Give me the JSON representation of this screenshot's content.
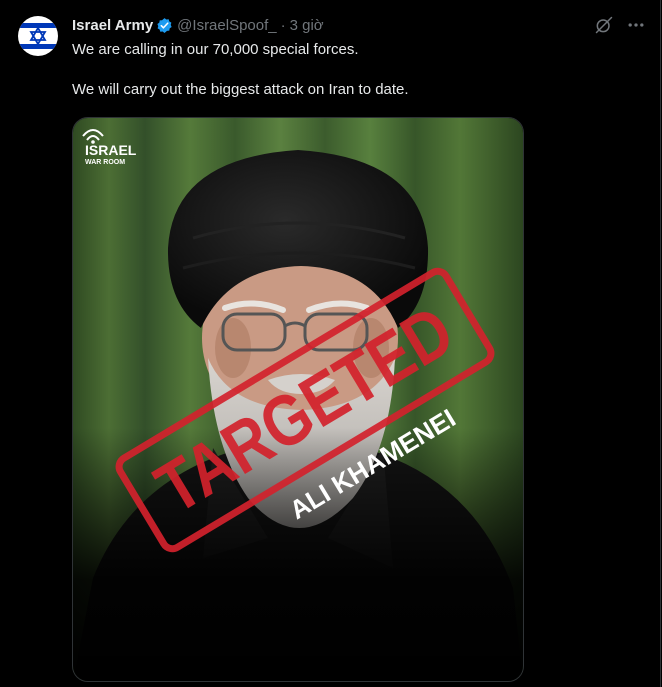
{
  "post": {
    "author_name": "Israel Army",
    "handle": "@IsraelSpoof_",
    "separator": "·",
    "time": "3 giờ",
    "text_line1": "We are calling in our 70,000 special forces.",
    "text_line2": "We will carry out the biggest attack on Iran to date."
  },
  "media": {
    "watermark_line1": "ISRAEL",
    "watermark_line2": "WAR ROOM",
    "stamp_text": "TARGETED",
    "caption": "ALI KHAMENEI"
  },
  "icons": {
    "verified": "verified-badge-icon",
    "grok": "grok-icon",
    "more": "more-icon"
  },
  "colors": {
    "verified": "#1d9bf0",
    "stamp": "#d3222c",
    "flag_blue": "#0038b8"
  }
}
